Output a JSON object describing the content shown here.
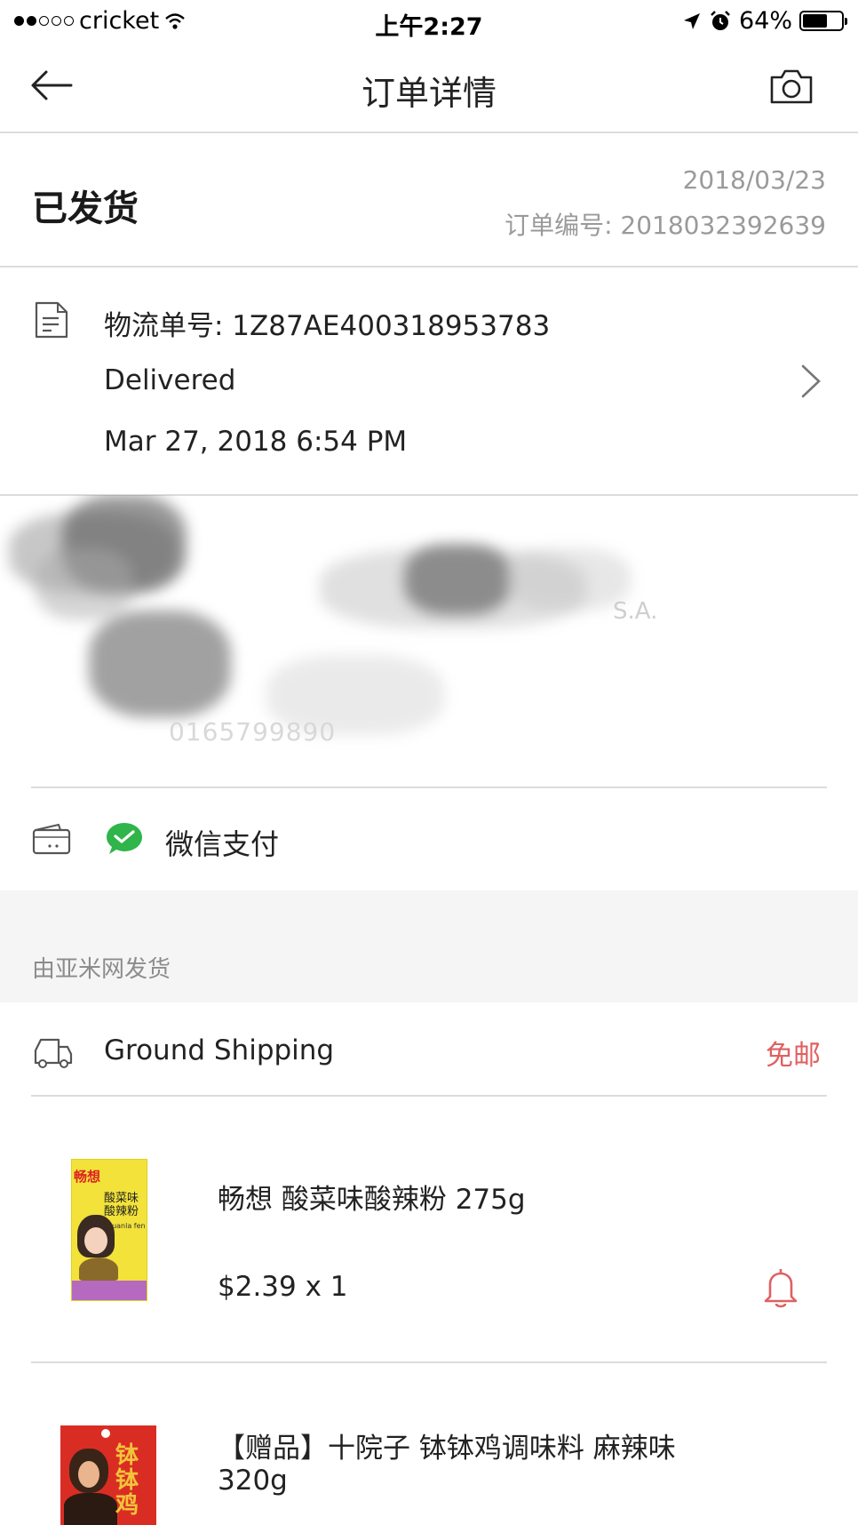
{
  "status_bar": {
    "carrier": "cricket",
    "time": "上午2:27",
    "battery": "64%",
    "battery_level": 0.64
  },
  "nav": {
    "title": "订单详情",
    "back_icon": "arrow-left-icon",
    "camera_icon": "camera-icon"
  },
  "order": {
    "status": "已发货",
    "date": "2018/03/23",
    "number_label": "订单编号: 2018032392639"
  },
  "tracking": {
    "number_label": "物流单号: 1Z87AE400318953783",
    "state": "Delivered",
    "time": "Mar 27, 2018 6:54 PM",
    "icon": "document-icon"
  },
  "address": {
    "fragment_country": "S.A.",
    "fragment_phone": "0165799890"
  },
  "payment": {
    "method": "微信支付",
    "wallet_icon": "wallet-icon",
    "wechat_icon": "wechat-icon"
  },
  "shipper": {
    "label": "由亚米网发货"
  },
  "shipping": {
    "method": "Ground Shipping",
    "fee": "免邮",
    "icon": "truck-icon"
  },
  "items": [
    {
      "name": "畅想 酸菜味酸辣粉 275g",
      "price_qty": "$2.39 x 1",
      "package_brand": "畅想",
      "package_label": "酸菜味酸辣粉",
      "package_sub": "Suanla fen",
      "bell_icon": "bell-icon"
    },
    {
      "name_line1": "【赠品】十院子 钵钵鸡调味料 麻辣味",
      "name_line2": "320g",
      "package_label": "钵钵鸡"
    }
  ],
  "colors": {
    "accent_red": "#e06060",
    "wechat_green": "#2fb54a",
    "divider": "#dcdcdc",
    "band": "#f5f5f5"
  }
}
